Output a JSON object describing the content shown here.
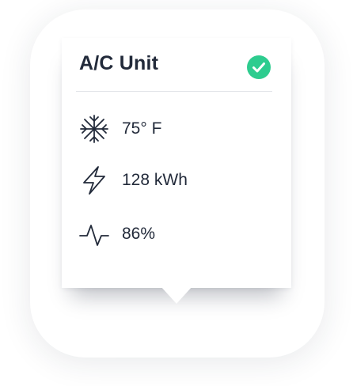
{
  "device": {
    "title": "A/C Unit",
    "status_icon": "check-circle-icon",
    "status_color": "#2ecc8f"
  },
  "metrics": [
    {
      "icon": "snowflake-icon",
      "value": "75° F"
    },
    {
      "icon": "lightning-bolt-icon",
      "value": "128 kWh"
    },
    {
      "icon": "activity-pulse-icon",
      "value": "86%"
    }
  ],
  "colors": {
    "text": "#222a3a",
    "divider": "#e2e4e8",
    "background": "#ffffff"
  }
}
